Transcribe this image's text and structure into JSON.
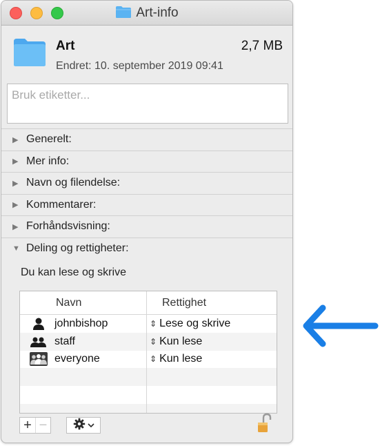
{
  "window": {
    "title": "Art-info",
    "item_name": "Art",
    "size": "2,7 MB",
    "modified": "Endret: 10. september 2019 09:41"
  },
  "tags": {
    "placeholder": "Bruk etiketter..."
  },
  "sections": [
    {
      "label": "Generelt:",
      "expanded": false
    },
    {
      "label": "Mer info:",
      "expanded": false
    },
    {
      "label": "Navn og filendelse:",
      "expanded": false
    },
    {
      "label": "Kommentarer:",
      "expanded": false
    },
    {
      "label": "Forhåndsvisning:",
      "expanded": false
    },
    {
      "label": "Deling og rettigheter:",
      "expanded": true
    }
  ],
  "sharing": {
    "status": "Du kan lese og skrive",
    "columns": {
      "name": "Navn",
      "privilege": "Rettighet"
    },
    "rows": [
      {
        "name": "johnbishop",
        "privilege": "Lese og skrive",
        "icon": "single-user-icon"
      },
      {
        "name": "staff",
        "privilege": "Kun lese",
        "icon": "group-icon"
      },
      {
        "name": "everyone",
        "privilege": "Kun lese",
        "icon": "everyone-icon"
      }
    ]
  },
  "controls": {
    "add": "+",
    "remove": "−",
    "action_icon": "gear-icon",
    "lock_icon": "unlocked-lock-icon"
  },
  "colors": {
    "folder": "#5ab3f2",
    "arrow": "#1a7fe6"
  }
}
